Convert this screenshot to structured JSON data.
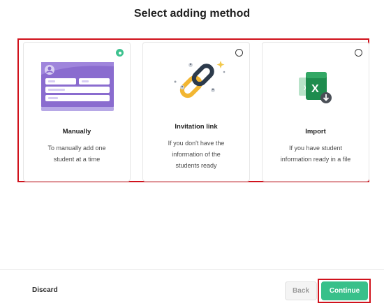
{
  "page": {
    "title": "Select adding method"
  },
  "options": [
    {
      "title": "Manually",
      "desc_lines": [
        "To manually add one",
        "student at a time"
      ],
      "selected": true,
      "icon": "student-form-card-icon"
    },
    {
      "title": "Invitation link",
      "desc_lines": [
        "If you don't have the",
        "information of the",
        "students ready"
      ],
      "selected": false,
      "icon": "chain-link-icon"
    },
    {
      "title": "Import",
      "desc_lines": [
        "If you have student",
        "information ready in a file"
      ],
      "selected": false,
      "icon": "excel-download-icon"
    }
  ],
  "footer": {
    "discard_label": "Discard",
    "back_label": "Back",
    "back_disabled": true,
    "continue_label": "Continue"
  },
  "colors": {
    "accent": "#38c08a",
    "highlight": "#d0121c",
    "card_purple": "#8a6ccf",
    "link_gold": "#f2b632",
    "link_dark": "#2c3a4b",
    "excel_green": "#1e8c4e"
  }
}
